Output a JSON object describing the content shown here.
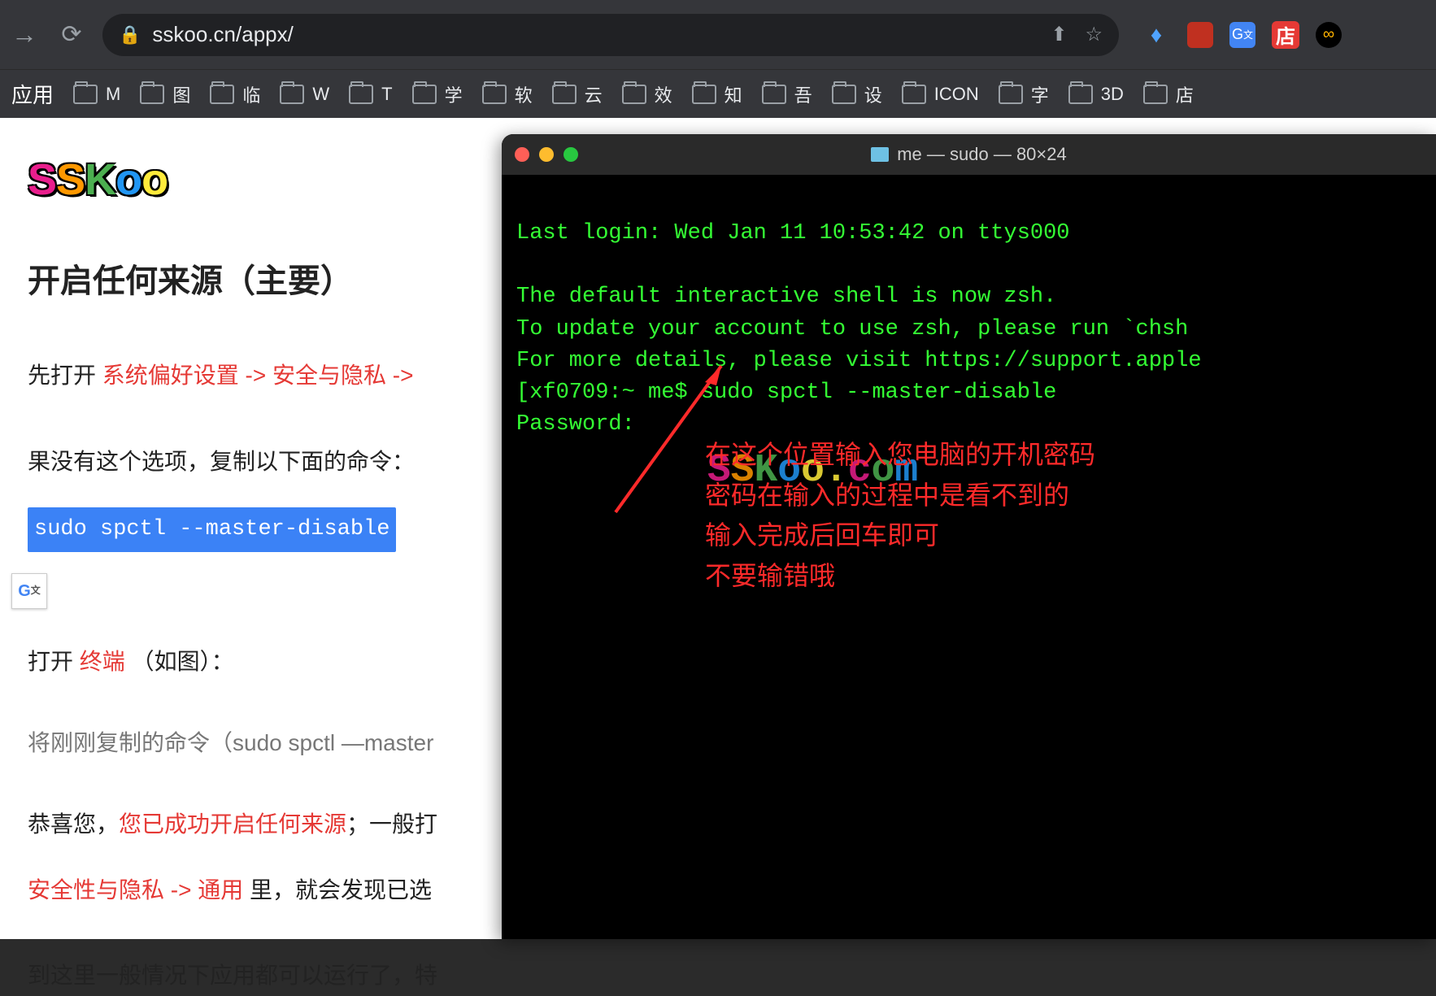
{
  "browser": {
    "url": "sskoo.cn/appx/",
    "bookmarks_label_apps": "应用",
    "bookmarks": [
      {
        "label": "M"
      },
      {
        "label": "图"
      },
      {
        "label": "临"
      },
      {
        "label": "W"
      },
      {
        "label": "T"
      },
      {
        "label": "学"
      },
      {
        "label": "软"
      },
      {
        "label": "云"
      },
      {
        "label": "效"
      },
      {
        "label": "知"
      },
      {
        "label": "吾"
      },
      {
        "label": "设"
      },
      {
        "label": "ICON"
      },
      {
        "label": "字"
      },
      {
        "label": "3D"
      },
      {
        "label": "店"
      }
    ]
  },
  "page": {
    "logo_text": "SSKoo",
    "heading": "开启任何来源（主要）",
    "line_open_prefix": "先打开 ",
    "line_open_red": "系统偏好设置 -> 安全与隐私 -> ",
    "line_no_option": "果没有这个选项，复制以下面的命令：",
    "command": "sudo spctl --master-disable",
    "line_terminal_prefix": "打开 ",
    "line_terminal_red": "终端",
    "line_terminal_suffix": " （如图）：",
    "line_paste": "将刚刚复制的命令（sudo spctl —master",
    "line_congrats_prefix": "恭喜您，",
    "line_congrats_red": "您已成功开启任何来源",
    "line_congrats_suffix": "；一般打",
    "line_security_red": "安全性与隐私 -> 通用 ",
    "line_security_suffix": "里，就会发现已选",
    "line_final": "到这里一般情况下应用都可以运行了，特"
  },
  "terminal": {
    "title": "me — sudo — 80×24",
    "line1": "Last login: Wed Jan 11 10:53:42 on ttys000",
    "line_blank": "",
    "line_shell1": "The default interactive shell is now zsh.",
    "line_shell2": "To update your account to use zsh, please run `chsh",
    "line_shell3": "For more details, please visit https://support.apple",
    "prompt": "xf0709:~ me$ sudo spctl --master-disable",
    "password": "Password:",
    "watermark": "SSKoo.com",
    "annotations": [
      "在这个位置输入您电脑的开机密码",
      "密码在输入的过程中是看不到的",
      "输入完成后回车即可",
      "不要输错哦"
    ]
  }
}
